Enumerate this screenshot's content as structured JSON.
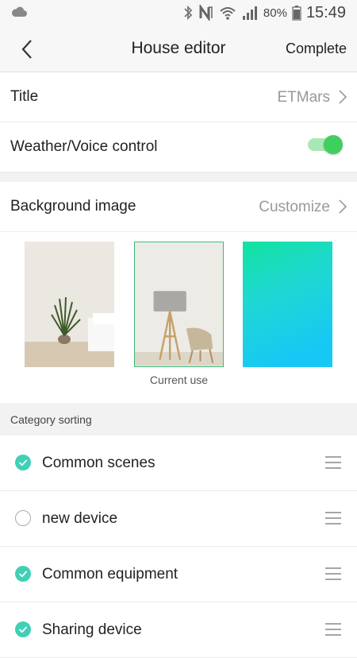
{
  "status_bar": {
    "battery": "80%",
    "time": "15:49"
  },
  "nav": {
    "title": "House editor",
    "complete_label": "Complete"
  },
  "settings": {
    "title_label": "Title",
    "title_value": "ETMars",
    "weather_label": "Weather/Voice control",
    "weather_enabled": true
  },
  "background": {
    "label": "Background image",
    "action": "Customize",
    "current_label": "Current use",
    "selected_index": 1
  },
  "category": {
    "section_title": "Category sorting",
    "items": [
      {
        "label": "Common scenes",
        "checked": true
      },
      {
        "label": "new device",
        "checked": false
      },
      {
        "label": "Common equipment",
        "checked": true
      },
      {
        "label": "Sharing device",
        "checked": true
      }
    ]
  },
  "colors": {
    "accent_check": "#3fd0b5",
    "toggle_on": "#3fcf5e"
  }
}
